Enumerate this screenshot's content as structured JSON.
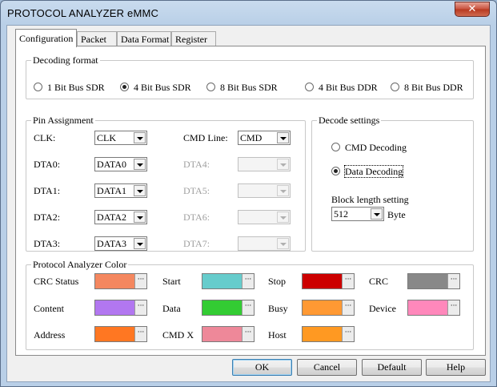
{
  "window": {
    "title": "PROTOCOL ANALYZER eMMC",
    "close_glyph": "✕"
  },
  "tabs": [
    {
      "label": "Configuration",
      "active": true
    },
    {
      "label": "Packet",
      "active": false
    },
    {
      "label": "Data Format",
      "active": false
    },
    {
      "label": "Register",
      "active": false
    }
  ],
  "decoding_format": {
    "label": "Decoding format",
    "options": [
      {
        "label": "1 Bit Bus SDR",
        "selected": false
      },
      {
        "label": "4 Bit Bus SDR",
        "selected": true
      },
      {
        "label": "8 Bit Bus SDR",
        "selected": false
      },
      {
        "label": "4 Bit Bus DDR",
        "selected": false
      },
      {
        "label": "8 Bit Bus DDR",
        "selected": false
      }
    ]
  },
  "pin_assignment": {
    "label": "Pin Assignment",
    "clk": {
      "label": "CLK:",
      "value": "CLK"
    },
    "cmd_line": {
      "label": "CMD Line:",
      "value": "CMD"
    },
    "dta0": {
      "label": "DTA0:",
      "value": "DATA0"
    },
    "dta1": {
      "label": "DTA1:",
      "value": "DATA1"
    },
    "dta2": {
      "label": "DTA2:",
      "value": "DATA2"
    },
    "dta3": {
      "label": "DTA3:",
      "value": "DATA3"
    },
    "dta4": {
      "label": "DTA4:",
      "value": ""
    },
    "dta5": {
      "label": "DTA5:",
      "value": ""
    },
    "dta6": {
      "label": "DTA6:",
      "value": ""
    },
    "dta7": {
      "label": "DTA7:",
      "value": ""
    }
  },
  "decode_settings": {
    "label": "Decode settings",
    "cmd_decoding": {
      "label": "CMD Decoding",
      "selected": false
    },
    "data_decoding": {
      "label": "Data Decoding",
      "selected": true
    },
    "block_length_label": "Block length setting",
    "block_length_value": "512",
    "block_length_unit": "Byte"
  },
  "color_group": {
    "label": "Protocol Analyzer Color",
    "more_glyph": "···",
    "items": [
      {
        "label": "CRC Status",
        "color": "#f4875f"
      },
      {
        "label": "Start",
        "color": "#66cccc"
      },
      {
        "label": "Stop",
        "color": "#cc0000"
      },
      {
        "label": "CRC",
        "color": "#888888"
      },
      {
        "label": "Content",
        "color": "#b277f0"
      },
      {
        "label": "Data",
        "color": "#33cc33"
      },
      {
        "label": "Busy",
        "color": "#ff9933"
      },
      {
        "label": "Device",
        "color": "#ff88bb"
      },
      {
        "label": "Address",
        "color": "#ff7722"
      },
      {
        "label": "CMD X",
        "color": "#ee8899"
      },
      {
        "label": "Host",
        "color": "#ff9922"
      }
    ]
  },
  "buttons": {
    "ok": "OK",
    "cancel": "Cancel",
    "default": "Default",
    "help": "Help"
  }
}
